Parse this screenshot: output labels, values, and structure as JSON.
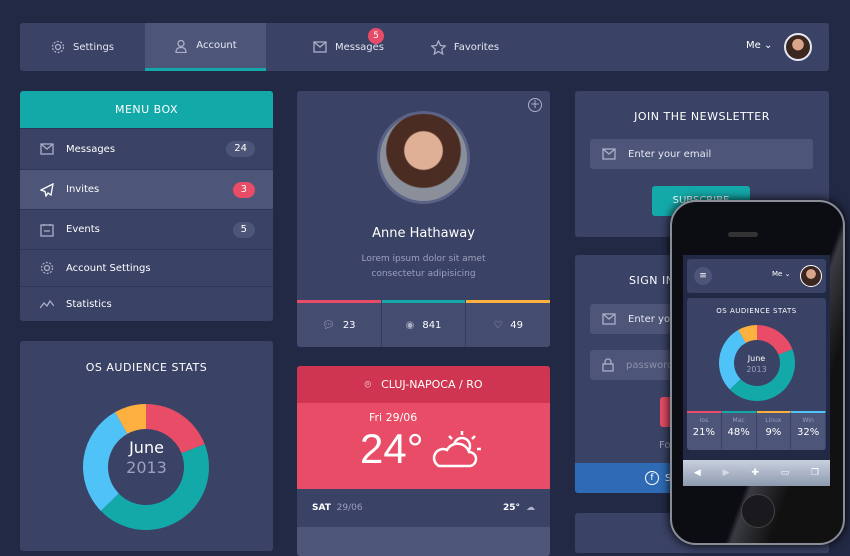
{
  "nav": {
    "tabs": [
      {
        "label": "Settings",
        "icon": "gear-icon"
      },
      {
        "label": "Account",
        "icon": "user-icon",
        "active": true
      },
      {
        "label": "Messages",
        "icon": "envelope-icon",
        "badge": "5"
      },
      {
        "label": "Favorites",
        "icon": "star-icon"
      }
    ],
    "user_menu": "Me"
  },
  "menu": {
    "title": "MENU BOX",
    "items": [
      {
        "label": "Messages",
        "count": "24"
      },
      {
        "label": "Invites",
        "count": "3"
      },
      {
        "label": "Events",
        "count": "5"
      },
      {
        "label": "Account Settings"
      },
      {
        "label": "Statistics"
      }
    ]
  },
  "profile": {
    "name": "Anne Hathaway",
    "bio": "Lorem ipsum dolor sit amet consectetur adipisicing",
    "comments": "23",
    "views": "841",
    "likes": "49"
  },
  "weather": {
    "location": "CLUJ-NAPOCA / RO",
    "date": "Fri 29/06",
    "temp": "24°",
    "forecast": [
      {
        "day": "SAT",
        "date": "29/06",
        "temp": "25°"
      }
    ]
  },
  "newsletter": {
    "title": "JOIN THE NEWSLETTER",
    "placeholder": "Enter your email",
    "button": "SUBSCRIBE"
  },
  "signin": {
    "title": "SIGN IN",
    "email_placeholder": "Enter your email",
    "password_placeholder": "password",
    "forgot": "Fo",
    "facebook": "S"
  },
  "stats": {
    "title": "OS AUDIENCE STATS",
    "month": "June",
    "year": "2013"
  },
  "phone": {
    "user_menu": "Me",
    "stats": {
      "title": "OS AUDIENCE STATS",
      "month": "June",
      "year": "2013"
    }
  },
  "colors": {
    "teal": "#14a9a9",
    "red": "#e84c66",
    "yellow": "#fbb040",
    "blue": "#4fc3f7"
  },
  "chart_data": {
    "type": "pie",
    "title": "OS AUDIENCE STATS",
    "categories": [
      "ios",
      "Mac",
      "Linux",
      "Win"
    ],
    "values": [
      21,
      48,
      9,
      32
    ],
    "labels": [
      "21%",
      "48%",
      "9%",
      "32%"
    ],
    "colors": [
      "#e84c66",
      "#14a9a9",
      "#fbb040",
      "#4fc3f7"
    ]
  }
}
